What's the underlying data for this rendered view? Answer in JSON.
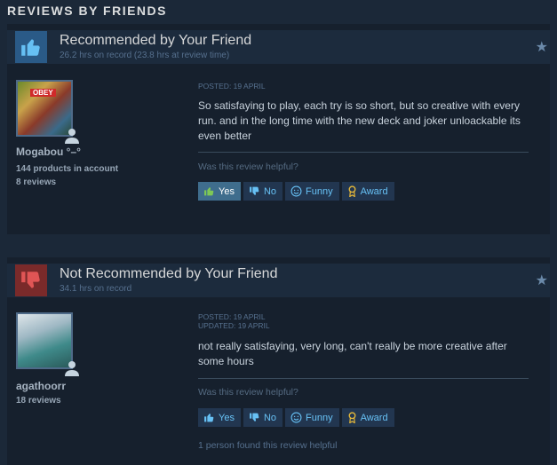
{
  "section_title": "REVIEWS BY FRIENDS",
  "reviews": [
    {
      "heading": "Recommended by Your Friend",
      "hours": "26.2 hrs on record (23.8 hrs at review time)",
      "author": "Mogabou °–°",
      "author_meta": [
        "144 products in account",
        "8 reviews"
      ],
      "avatar_text": "OBEY",
      "posted": "POSTED: 19 APRIL",
      "updated": "",
      "text": "So satisfaying to play, each try is so short, but so creative with every run. and in the long time with the new deck and joker unloackable its even better",
      "helpful_q": "Was this review helpful?",
      "buttons": {
        "yes": "Yes",
        "no": "No",
        "funny": "Funny",
        "award": "Award"
      },
      "found": ""
    },
    {
      "heading": "Not Recommended by Your Friend",
      "hours": "34.1 hrs on record",
      "author": "agathoorr",
      "author_meta": [
        "18 reviews"
      ],
      "posted": "POSTED: 19 APRIL",
      "updated": "UPDATED: 19 APRIL",
      "text": "not really satisfaying, very long, can't really be more creative after some hours",
      "helpful_q": "Was this review helpful?",
      "buttons": {
        "yes": "Yes",
        "no": "No",
        "funny": "Funny",
        "award": "Award"
      },
      "found": "1 person found this review helpful"
    }
  ],
  "icons": {
    "thumbs_up": "thumbs-up-icon",
    "thumbs_down": "thumbs-down-icon",
    "star": "star-icon",
    "person": "friend-icon",
    "smile": "smile-icon",
    "award": "award-icon"
  },
  "colors": {
    "page_bg": "#1b2838",
    "card_bg": "#16202d",
    "header_bg": "#1c2b3d",
    "recommend": "#66c0f4",
    "not_recommend": "#d94f4f",
    "link": "#67c1f5"
  }
}
